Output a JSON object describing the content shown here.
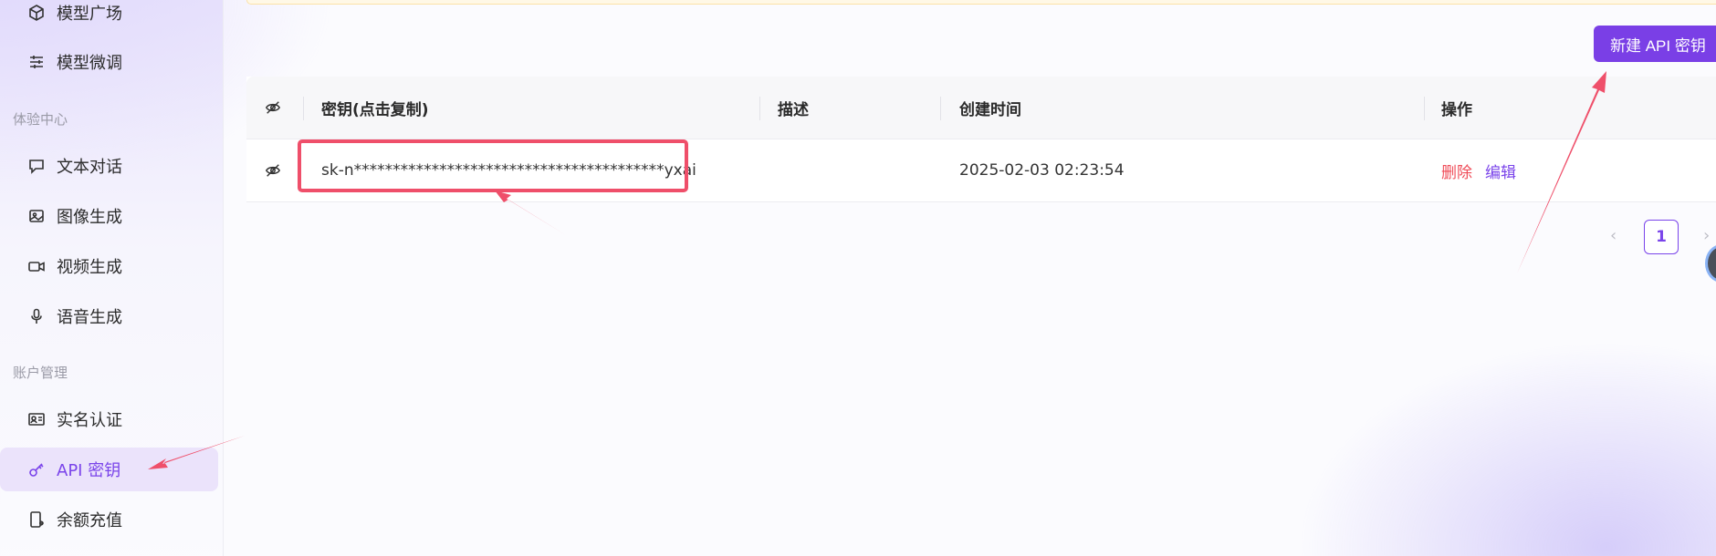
{
  "sidebar": {
    "items_top": [
      {
        "label": "模型广场",
        "icon": "cube-icon"
      },
      {
        "label": "模型微调",
        "icon": "sliders-icon"
      }
    ],
    "group_experience": "体验中心",
    "items_experience": [
      {
        "label": "文本对话",
        "icon": "chat-bubble-icon"
      },
      {
        "label": "图像生成",
        "icon": "image-icon"
      },
      {
        "label": "视频生成",
        "icon": "video-camera-icon"
      },
      {
        "label": "语音生成",
        "icon": "microphone-icon"
      }
    ],
    "group_account": "账户管理",
    "items_account": [
      {
        "label": "实名认证",
        "icon": "id-card-icon"
      },
      {
        "label": "API 密钥",
        "icon": "key-icon",
        "active": true
      },
      {
        "label": "余额充值",
        "icon": "wallet-recharge-icon"
      }
    ]
  },
  "toolbar": {
    "new_key_label": "新建 API 密钥"
  },
  "table": {
    "columns": [
      "密钥(点击复制)",
      "描述",
      "创建时间",
      "操作"
    ],
    "rows": [
      {
        "key": "sk-n****************************************yxai",
        "description": "",
        "created": "2025-02-03 02:23:54",
        "actions": [
          "删除",
          "编辑"
        ]
      }
    ]
  },
  "pagination": {
    "prev": "‹",
    "current": "1",
    "next": "›"
  },
  "colors": {
    "accent": "#7a44ea",
    "button": "#7a3fe6",
    "danger": "#ef4c58",
    "annotation": "#ef4f6a"
  }
}
